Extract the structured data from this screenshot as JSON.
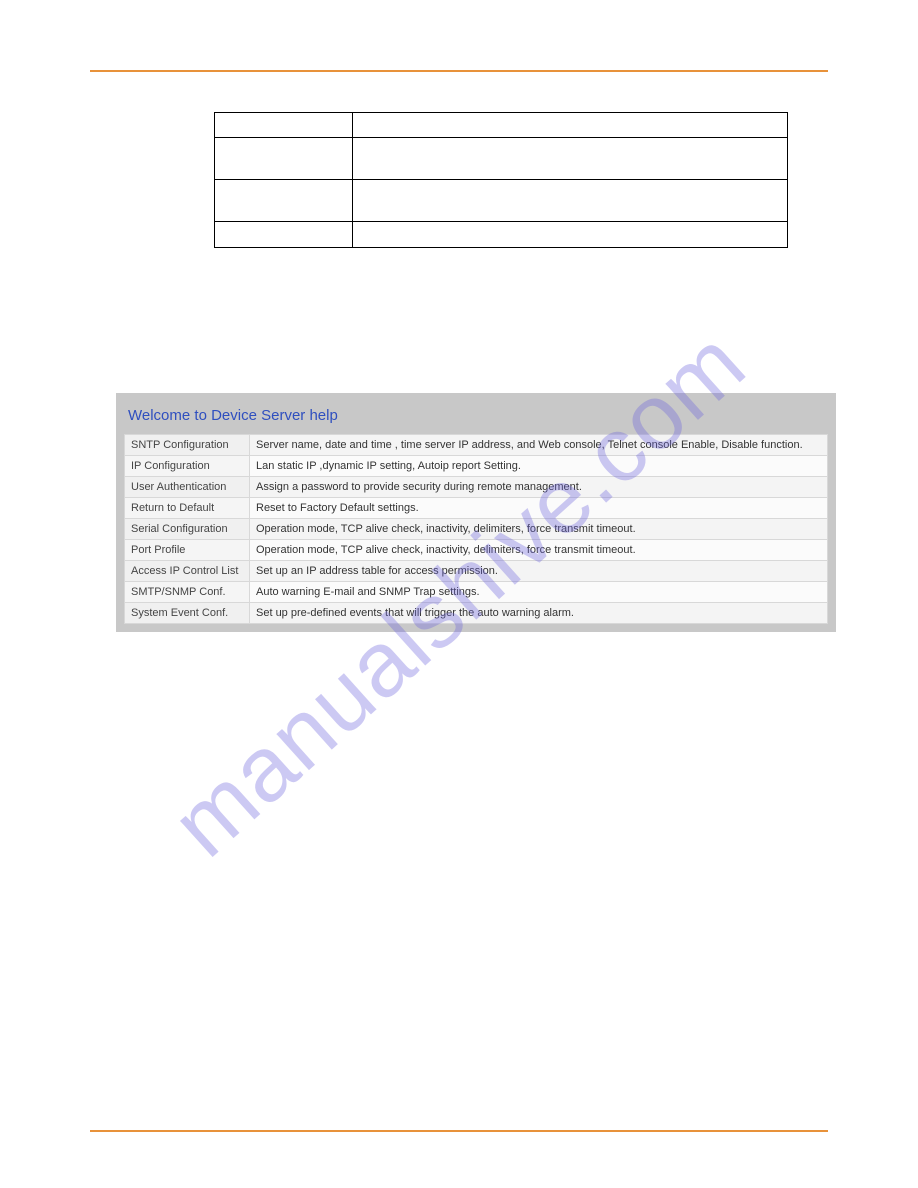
{
  "watermark": "manualshive.com",
  "help": {
    "title": "Welcome to Device Server help",
    "rows": [
      {
        "label": "SNTP Configuration",
        "desc": "Server name, date and time , time server IP address, and Web console, Telnet console Enable, Disable function."
      },
      {
        "label": "IP Configuration",
        "desc": "Lan static IP ,dynamic IP setting, Autoip report Setting."
      },
      {
        "label": "User Authentication",
        "desc": "Assign a password to provide security during remote management."
      },
      {
        "label": "Return to Default",
        "desc": "Reset to Factory Default settings."
      },
      {
        "label": "Serial Configuration",
        "desc": "Operation mode, TCP alive check, inactivity, delimiters, force transmit timeout."
      },
      {
        "label": "Port Profile",
        "desc": "Operation mode, TCP alive check, inactivity, delimiters, force transmit timeout."
      },
      {
        "label": "Access IP Control List",
        "desc": "Set up an IP address table for access permission."
      },
      {
        "label": "SMTP/SNMP Conf.",
        "desc": "Auto warning E-mail and SNMP Trap settings."
      },
      {
        "label": "System Event Conf.",
        "desc": "Set up pre-defined events that will trigger the auto warning alarm."
      }
    ]
  }
}
